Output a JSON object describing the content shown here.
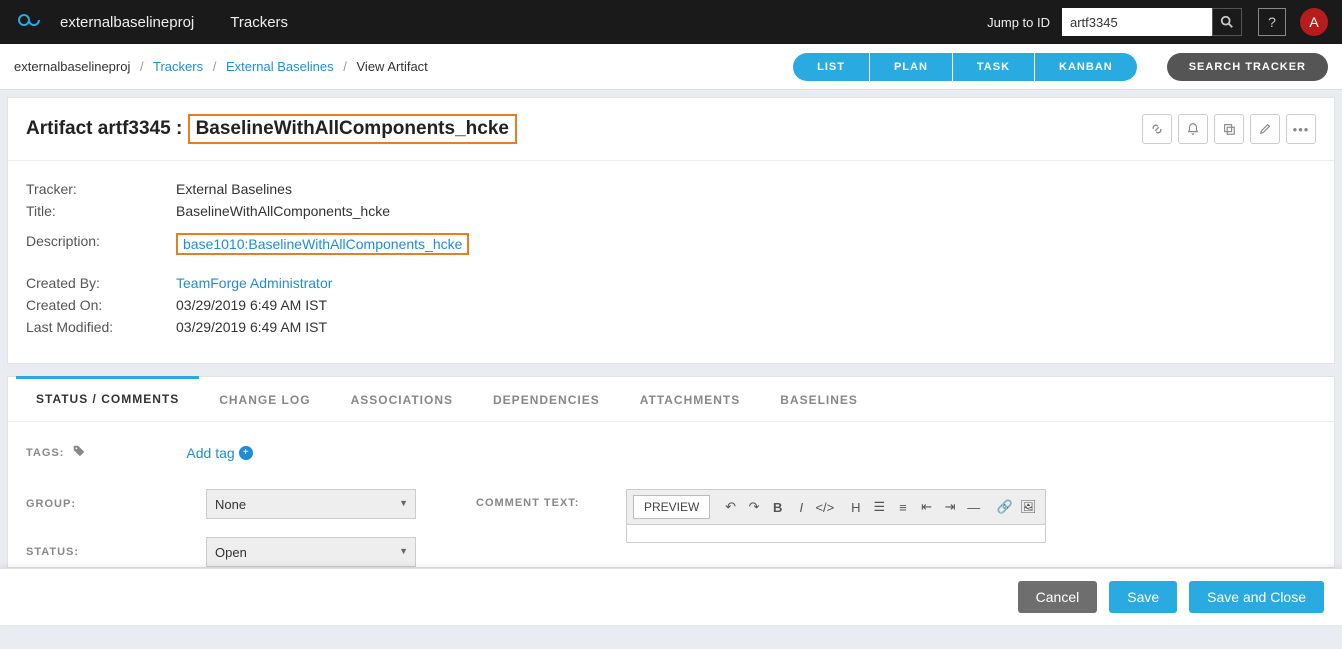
{
  "topbar": {
    "project": "externalbaselineproj",
    "mainlink": "Trackers",
    "jump_label": "Jump to ID",
    "search_value": "artf3345",
    "help": "?",
    "avatar": "A"
  },
  "breadcrumb": {
    "items": [
      "externalbaselineproj",
      "Trackers",
      "External Baselines",
      "View Artifact"
    ]
  },
  "viewnav": {
    "items": [
      "LIST",
      "PLAN",
      "TASK",
      "KANBAN"
    ],
    "search_tracker": "SEARCH TRACKER"
  },
  "artifact": {
    "id_label": "Artifact artf3345 : ",
    "title_hl": "BaselineWithAllComponents_hcke",
    "fields": {
      "tracker_label": "Tracker:",
      "tracker_value": "External Baselines",
      "title_label": "Title:",
      "title_value": "BaselineWithAllComponents_hcke",
      "description_label": "Description:",
      "description_link": "base1010:BaselineWithAllComponents_hcke",
      "created_by_label": "Created By:",
      "created_by_link": "TeamForge Administrator",
      "created_on_label": "Created On:",
      "created_on_value": "03/29/2019 6:49 AM IST",
      "last_modified_label": "Last Modified:",
      "last_modified_value": "03/29/2019 6:49 AM IST"
    }
  },
  "tabs": {
    "items": [
      "STATUS / COMMENTS",
      "CHANGE LOG",
      "ASSOCIATIONS",
      "DEPENDENCIES",
      "ATTACHMENTS",
      "BASELINES"
    ],
    "active_index": 0
  },
  "status": {
    "tags_label": "TAGS:",
    "add_tag": "Add tag",
    "group_label": "GROUP:",
    "group_value": "None",
    "status_label": "STATUS:",
    "status_value": "Open",
    "comment_label": "COMMENT TEXT:",
    "preview": "PREVIEW"
  },
  "footer": {
    "cancel": "Cancel",
    "save": "Save",
    "save_close": "Save and Close"
  }
}
